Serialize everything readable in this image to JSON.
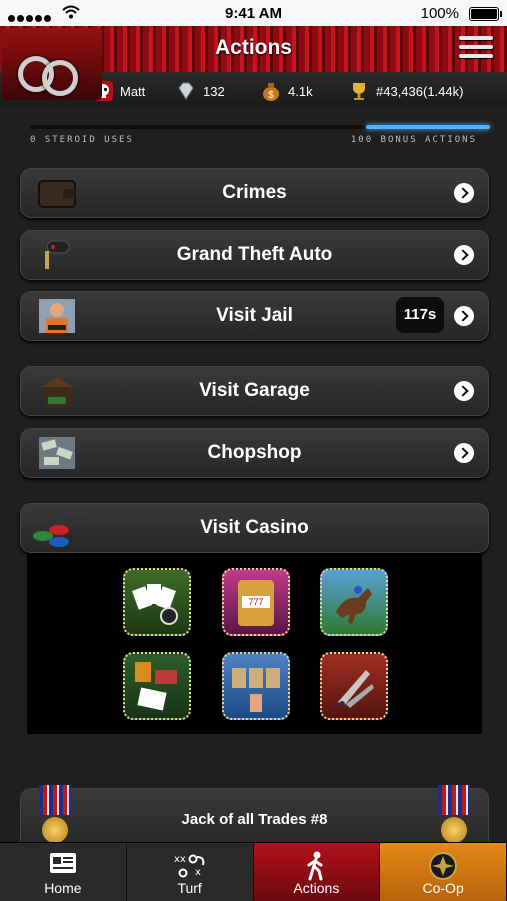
{
  "status_bar": {
    "time": "9:41 AM",
    "battery": "100%"
  },
  "header": {
    "title": "Actions"
  },
  "stats": {
    "username": "Matt",
    "diamonds": "132",
    "cash": "4.1k",
    "rank": "#43,436(1.44k)"
  },
  "progress": {
    "left_caption": "0 STEROID USES",
    "right_caption": "100 BONUS ACTIONS",
    "fill_fraction": 0.27
  },
  "actions": [
    {
      "label": "Crimes"
    },
    {
      "label": "Grand Theft Auto"
    },
    {
      "label": "Visit Jail",
      "badge": "117s"
    },
    {
      "label": "Visit Garage"
    },
    {
      "label": "Chopshop"
    }
  ],
  "casino": {
    "label": "Visit Casino",
    "games": [
      "poker-game-icon",
      "slot-machine-game-icon",
      "horse-racing-game-icon",
      "blackjack-game-icon",
      "card-choice-game-icon",
      "knife-game-icon"
    ]
  },
  "achievement": {
    "title": "Jack of all Trades #8"
  },
  "tabbar": [
    {
      "label": "Home",
      "icon": "home-icon"
    },
    {
      "label": "Turf",
      "icon": "turf-playbook-icon"
    },
    {
      "label": "Actions",
      "icon": "walking-person-icon"
    },
    {
      "label": "Co-Op",
      "icon": "co-op-badge-icon"
    }
  ],
  "colors": {
    "header_red": "#c4151f",
    "progress_blue": "#4fb3ff",
    "coop_orange": "#e38a17"
  }
}
